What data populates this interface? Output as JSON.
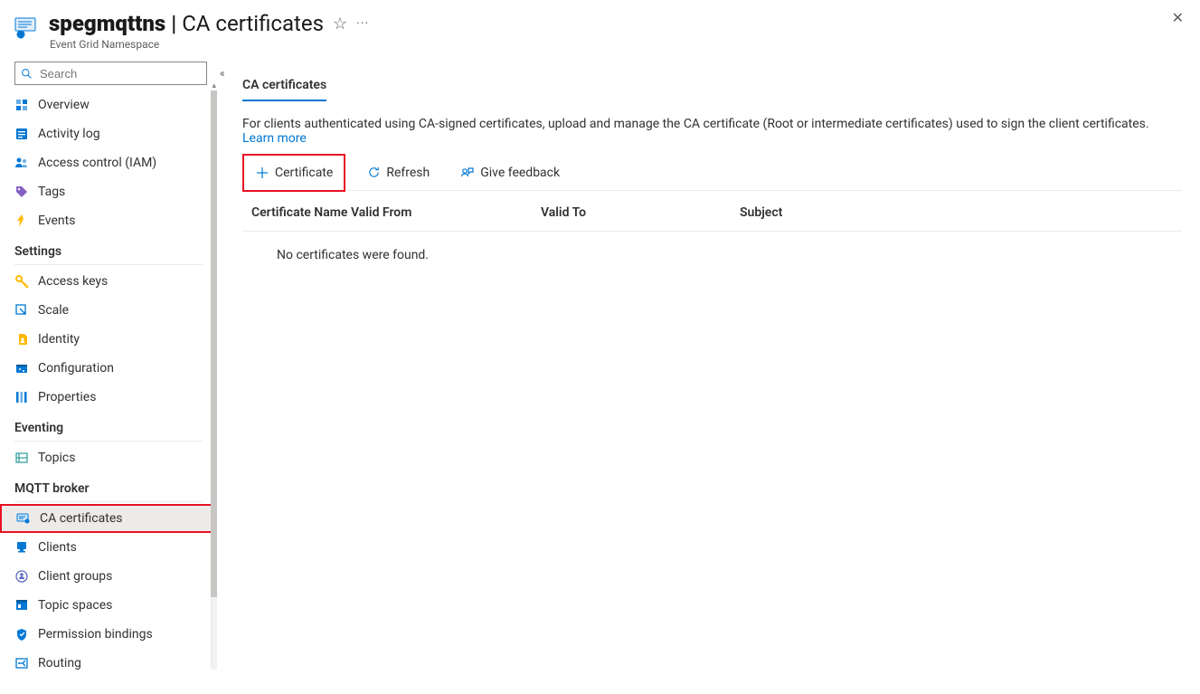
{
  "header": {
    "resource_name": "spegmqttns",
    "title_separator": " | ",
    "page_name": "CA certificates",
    "subtitle": "Event Grid Namespace"
  },
  "sidebar": {
    "search_placeholder": "Search",
    "top_items": [
      {
        "label": "Overview",
        "icon": "overview"
      },
      {
        "label": "Activity log",
        "icon": "activitylog"
      },
      {
        "label": "Access control (IAM)",
        "icon": "iam"
      },
      {
        "label": "Tags",
        "icon": "tags"
      },
      {
        "label": "Events",
        "icon": "events"
      }
    ],
    "groups": [
      {
        "title": "Settings",
        "items": [
          {
            "label": "Access keys",
            "icon": "key"
          },
          {
            "label": "Scale",
            "icon": "scale"
          },
          {
            "label": "Identity",
            "icon": "identity"
          },
          {
            "label": "Configuration",
            "icon": "config"
          },
          {
            "label": "Properties",
            "icon": "props"
          }
        ]
      },
      {
        "title": "Eventing",
        "items": [
          {
            "label": "Topics",
            "icon": "topics"
          }
        ]
      },
      {
        "title": "MQTT broker",
        "items": [
          {
            "label": "CA certificates",
            "icon": "cert",
            "selected": true,
            "highlighted": true
          },
          {
            "label": "Clients",
            "icon": "clients"
          },
          {
            "label": "Client groups",
            "icon": "cgroups"
          },
          {
            "label": "Topic spaces",
            "icon": "tspaces"
          },
          {
            "label": "Permission bindings",
            "icon": "perm"
          },
          {
            "label": "Routing",
            "icon": "routing"
          }
        ]
      }
    ]
  },
  "main": {
    "tab_label": "CA certificates",
    "description": "For clients authenticated using CA-signed certificates, upload and manage the CA certificate (Root or intermediate certificates) used to sign the client certificates. ",
    "learn_more": "Learn more",
    "toolbar": {
      "add_label": "Certificate",
      "refresh_label": "Refresh",
      "feedback_label": "Give feedback"
    },
    "columns": {
      "name": "Certificate Name",
      "from": "Valid From",
      "to": "Valid To",
      "subject": "Subject"
    },
    "empty_message": "No certificates were found."
  }
}
